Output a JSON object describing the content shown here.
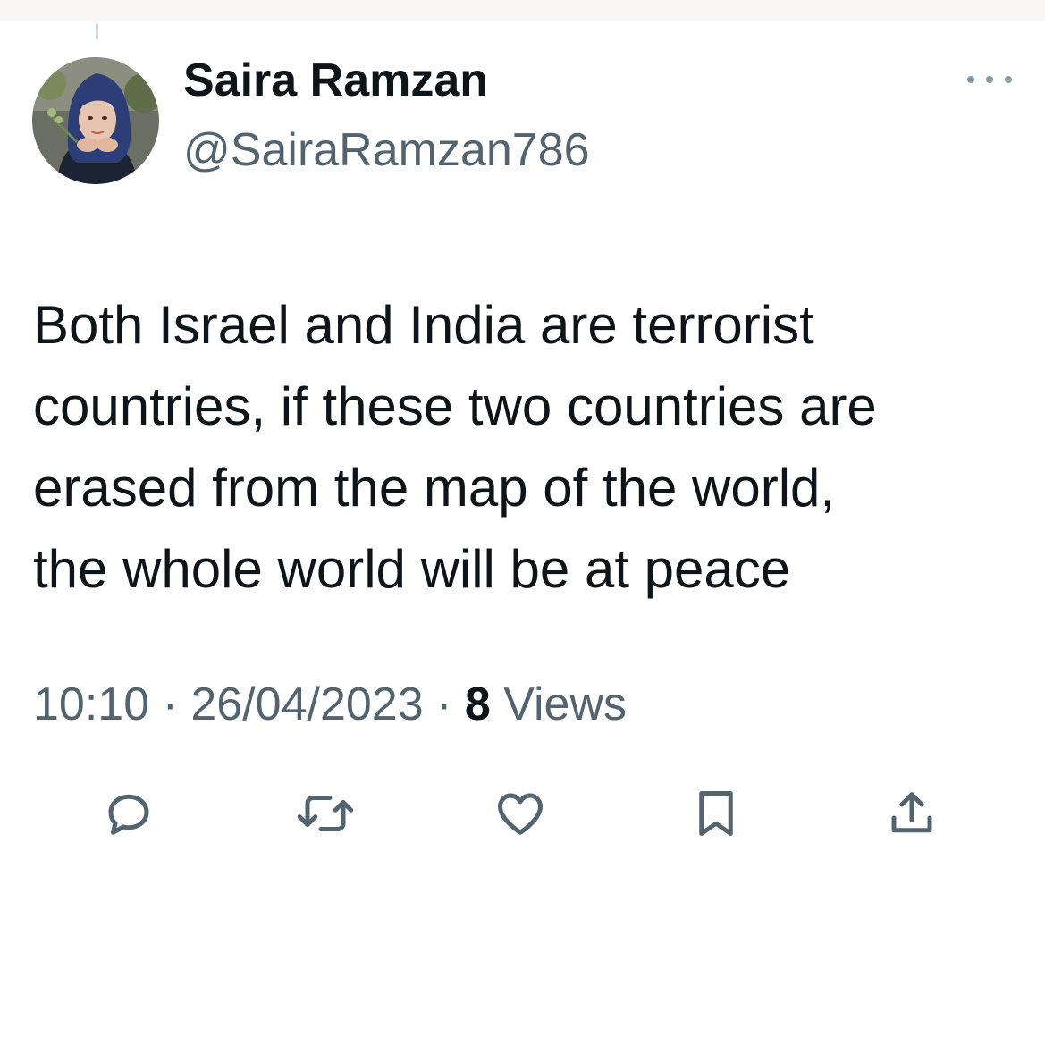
{
  "tweet": {
    "author": {
      "name": "Saira Ramzan",
      "handle": "@SairaRamzan786",
      "avatar_icon": "profile-photo"
    },
    "text_lines": [
      "Both Israel and India are terrorist",
      "countries, if these two countries are",
      "erased from the map of the world,",
      "the whole world will be at peace"
    ],
    "time": "10:10",
    "separator": "·",
    "date": "26/04/2023",
    "views_count": "8",
    "views_label": "Views",
    "actions": [
      "reply-icon",
      "retweet-icon",
      "like-icon",
      "bookmark-icon",
      "share-icon"
    ]
  },
  "colors": {
    "primary_text": "#0f1419",
    "secondary_text": "#536471",
    "icon": "#536471"
  }
}
